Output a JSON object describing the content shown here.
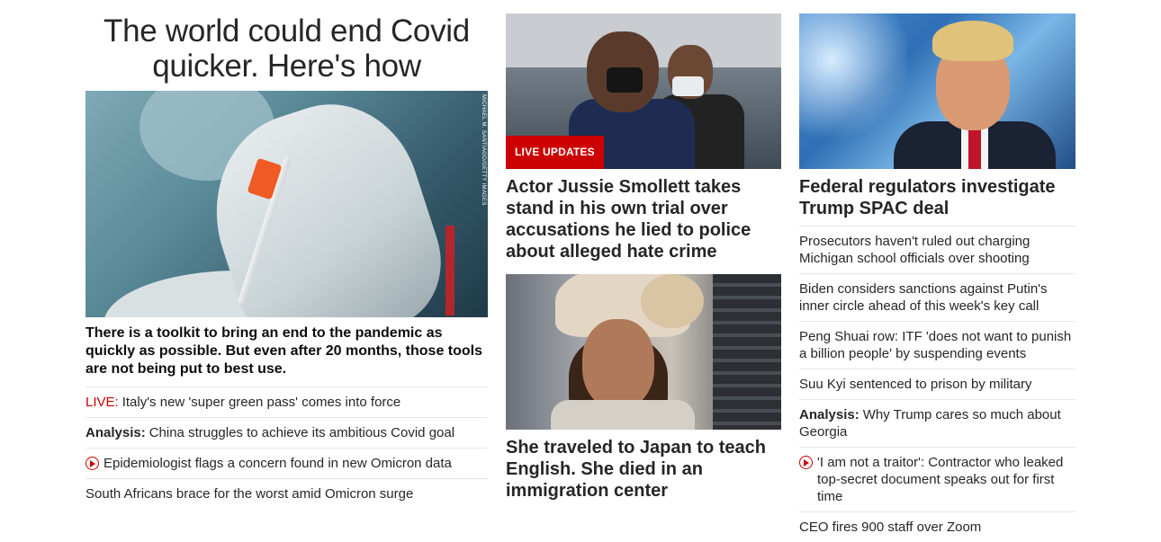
{
  "left": {
    "hero_title": "The world could end Covid quicker. Here's how",
    "image_credit": "MICHAEL M. SANTIAGO/GETTY IMAGES",
    "hero_desc": "There is a toolkit to bring an end to the pandemic as quickly as possible. But even after 20 months, those tools are not being put to best use.",
    "items": [
      {
        "prefix": "LIVE:",
        "text": "Italy's new 'super green pass' comes into force"
      },
      {
        "prefix": "Analysis:",
        "text": "China struggles to achieve its ambitious Covid goal"
      },
      {
        "icon": "play-video-icon",
        "text": "Epidemiologist flags a concern found in new Omicron data"
      },
      {
        "text": "South Africans brace for the worst amid Omicron surge"
      }
    ]
  },
  "middle": {
    "badge": "LIVE UPDATES",
    "story1_headline": "Actor Jussie Smollett takes stand in his own trial over accusations he lied to police about alleged hate crime",
    "story2_headline": "She traveled to Japan to teach English. She died in an immigration center"
  },
  "right": {
    "headline": "Federal regulators investigate Trump SPAC deal",
    "items": [
      {
        "text": "Prosecutors haven't ruled out charging Michigan school officials over shooting"
      },
      {
        "text": "Biden considers sanctions against Putin's inner circle ahead of this week's key call"
      },
      {
        "text": "Peng Shuai row: ITF 'does not want to punish a billion people' by suspending events"
      },
      {
        "text": "Suu Kyi sentenced to prison by military"
      },
      {
        "prefix": "Analysis:",
        "text": "Why Trump cares so much about Georgia"
      },
      {
        "icon": "play-video-icon",
        "text": "'I am not a traitor': Contractor who leaked top-secret document speaks out for first time"
      },
      {
        "text": "CEO fires 900 staff over Zoom"
      }
    ]
  },
  "colors": {
    "accent_red": "#cc0000",
    "text": "#262626",
    "divider": "#e6e6e6"
  }
}
